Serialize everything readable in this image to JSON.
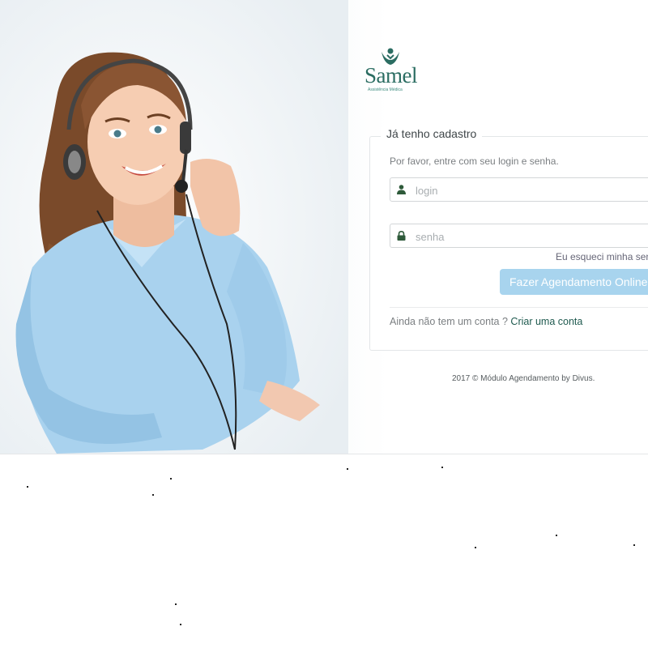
{
  "brand": {
    "name": "Samel",
    "subtitle": "Assistência Médica",
    "color": "#2b6d62"
  },
  "login_panel": {
    "legend": "Já tenho cadastro",
    "instructions": "Por favor, entre com seu login e senha.",
    "login_placeholder": "login",
    "password_placeholder": "senha",
    "forgot_password": "Eu esqueci minha sen",
    "submit_label": "Fazer Agendamento Online",
    "signup_prompt": "Ainda não tem um conta ?",
    "signup_link": "Criar uma conta"
  },
  "footer": {
    "text": "2017 © Módulo Agendamento by Divus."
  },
  "colors": {
    "button": "#a8d4ee",
    "link": "#1f5a4f",
    "icon": "#2e5a3a"
  }
}
